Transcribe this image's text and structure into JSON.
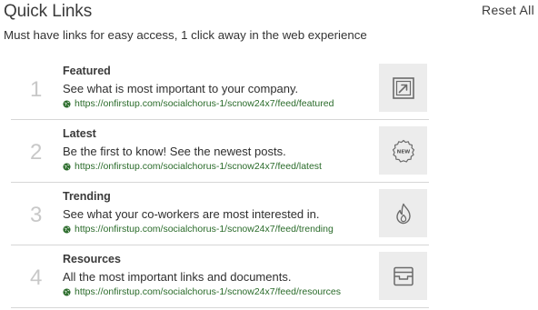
{
  "header": {
    "title": "Quick Links",
    "reset_label": "Reset All",
    "subtitle": "Must have links for easy access, 1 click away in the web experience"
  },
  "links": [
    {
      "number": "1",
      "title": "Featured",
      "description": "See what is most important to your company.",
      "url": "https://onfirstup.com/socialchorus-1/scnow24x7/feed/featured",
      "icon": "featured-arrow-icon"
    },
    {
      "number": "2",
      "title": "Latest",
      "description": "Be the first to know! See the newest posts.",
      "url": "https://onfirstup.com/socialchorus-1/scnow24x7/feed/latest",
      "icon": "new-badge-icon"
    },
    {
      "number": "3",
      "title": "Trending",
      "description": "See what your co-workers are most interested in.",
      "url": "https://onfirstup.com/socialchorus-1/scnow24x7/feed/trending",
      "icon": "flame-icon"
    },
    {
      "number": "4",
      "title": "Resources",
      "description": "All the most important links and documents.",
      "url": "https://onfirstup.com/socialchorus-1/scnow24x7/feed/resources",
      "icon": "archive-box-icon"
    }
  ],
  "colors": {
    "url_green": "#2a6b2a",
    "number_gray": "#c8c8c8",
    "icon_bg": "#ececec"
  }
}
